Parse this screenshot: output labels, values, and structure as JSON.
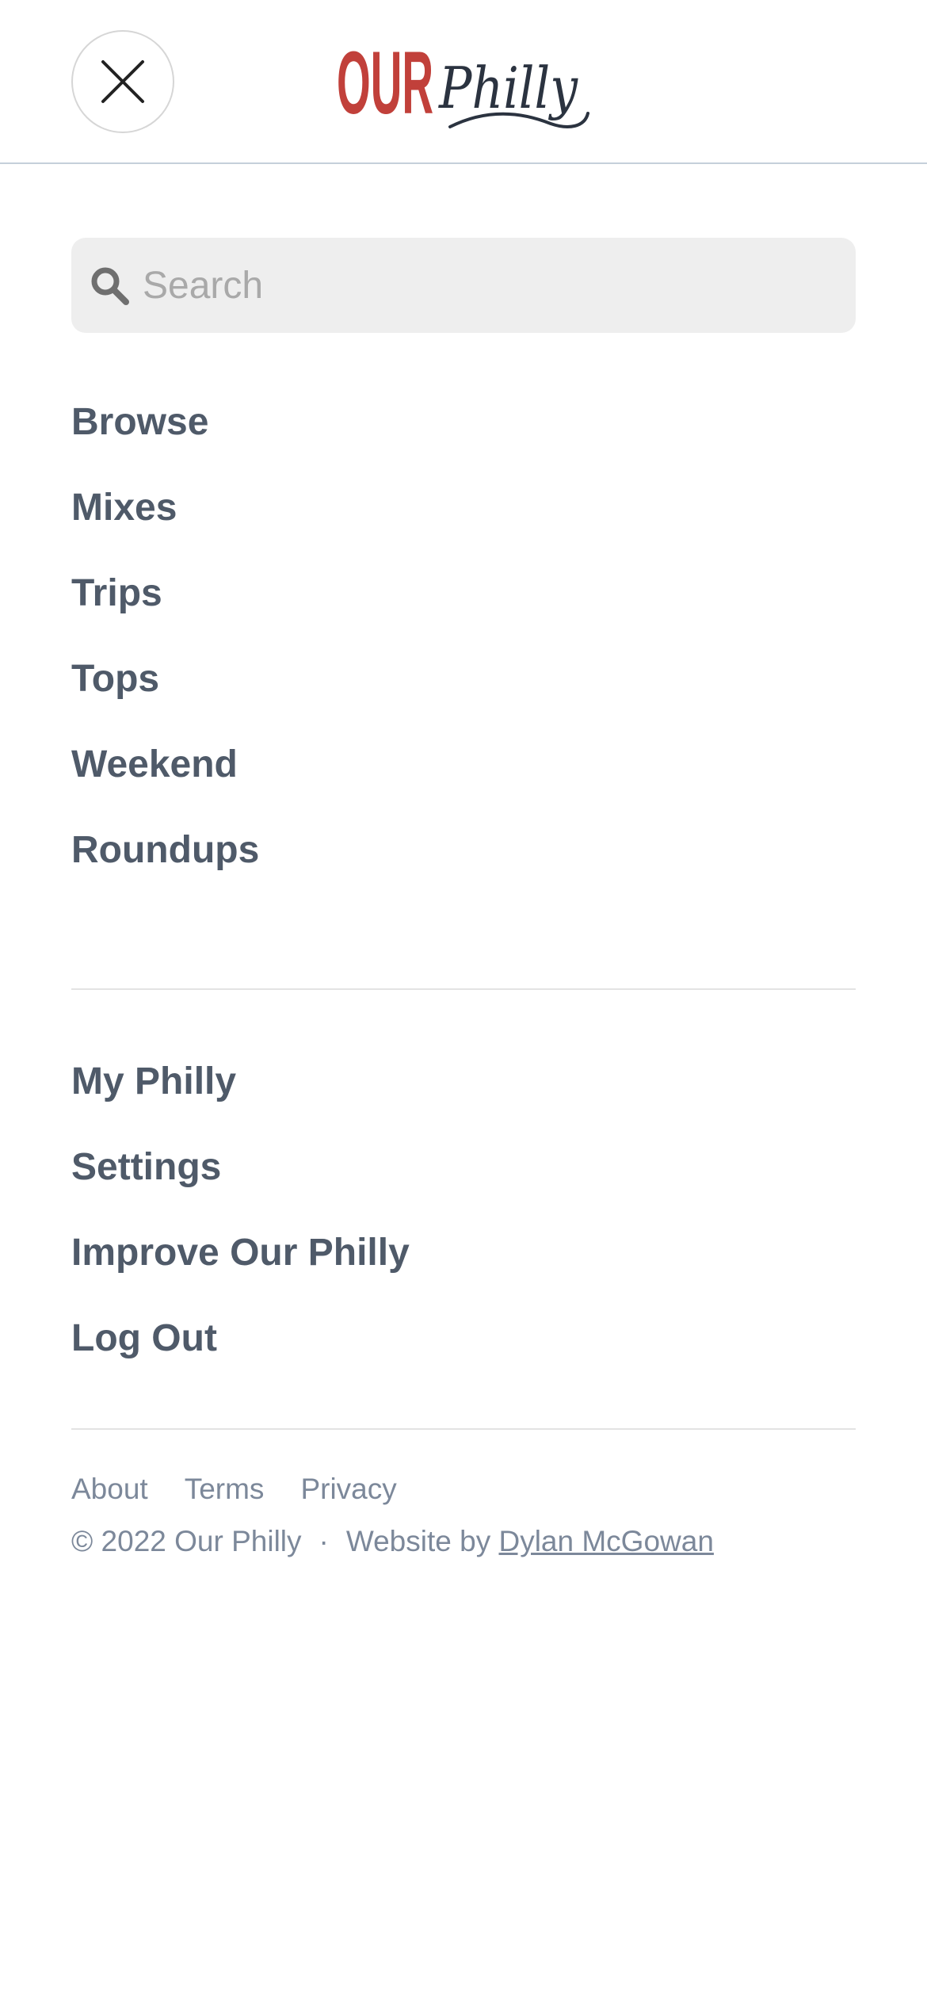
{
  "header": {
    "logo_text_bold": "OUR",
    "logo_text_script": "Philly",
    "brand_color": "#c1403a",
    "script_color": "#2b3340",
    "close_icon": "close-icon"
  },
  "search": {
    "placeholder": "Search",
    "value": "",
    "icon": "search-icon"
  },
  "nav_main": [
    {
      "label": "Browse"
    },
    {
      "label": "Mixes"
    },
    {
      "label": "Trips"
    },
    {
      "label": "Tops"
    },
    {
      "label": "Weekend"
    },
    {
      "label": "Roundups"
    }
  ],
  "nav_account": [
    {
      "label": "My Philly"
    },
    {
      "label": "Settings"
    },
    {
      "label": "Improve Our Philly"
    },
    {
      "label": "Log Out"
    }
  ],
  "footer": {
    "links": [
      {
        "label": "About"
      },
      {
        "label": "Terms"
      },
      {
        "label": "Privacy"
      }
    ],
    "copyright": "© 2022 Our Philly",
    "separator": "·",
    "credit_prefix": "Website by",
    "credit_name": "Dylan McGowan"
  },
  "colors": {
    "nav_text": "#4f5a69",
    "footer_text": "#7c889a",
    "search_bg": "#eeeeee"
  }
}
